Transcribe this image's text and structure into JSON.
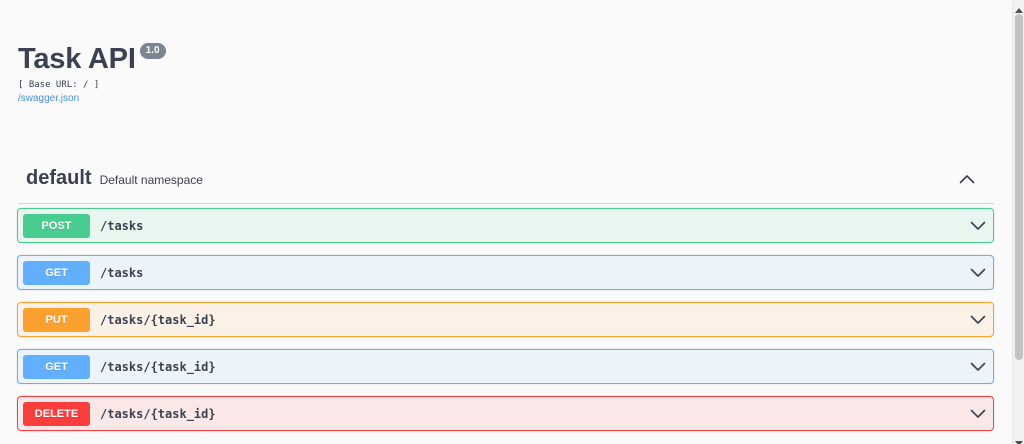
{
  "info": {
    "title": "Task API",
    "version": "1.0",
    "base_url": "[ Base URL: / ]",
    "spec_link": "/swagger.json"
  },
  "namespace": {
    "name": "default",
    "description": "Default namespace",
    "toggle_icon": "chevron-up-icon"
  },
  "operations": [
    {
      "method": "POST",
      "path": "/tasks",
      "color": "#49cc90",
      "bg": "#e8f6f0",
      "border": "#49cc90"
    },
    {
      "method": "GET",
      "path": "/tasks",
      "color": "#61affe",
      "bg": "#ebf3fb",
      "border": "#61affe"
    },
    {
      "method": "PUT",
      "path": "/tasks/{task_id}",
      "color": "#fca130",
      "bg": "#fbf1e6",
      "border": "#fca130"
    },
    {
      "method": "GET",
      "path": "/tasks/{task_id}",
      "color": "#61affe",
      "bg": "#ebf3fb",
      "border": "#61affe"
    },
    {
      "method": "DELETE",
      "path": "/tasks/{task_id}",
      "color": "#f93e3e",
      "bg": "#fae7e7",
      "border": "#f93e3e"
    }
  ],
  "icons": {
    "expand": "chevron-down-icon",
    "collapse": "chevron-up-icon"
  }
}
